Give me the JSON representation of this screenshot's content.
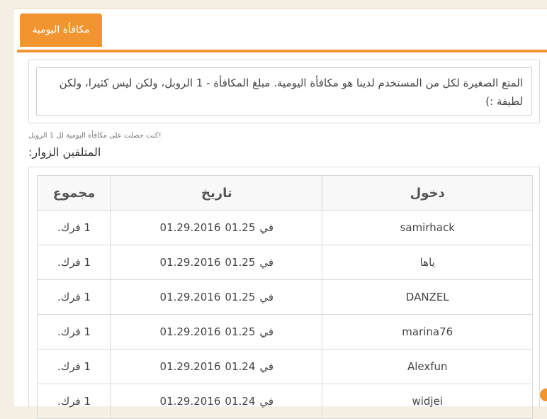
{
  "tab": {
    "label": "مكافأة اليومية"
  },
  "info": {
    "text": "المتع الصغيرة لكل من المستخدم لدينا هو مكافأة اليومية. مبلغ المكافأة - 1 الروبل، ولكن ليس كثيرا، ولكن لطيفة :)"
  },
  "note": {
    "text": "!كنت حصلت على مكافأة اليومية لل 1 الروبل"
  },
  "visitors": {
    "label": "المتلقين الزوار:"
  },
  "table": {
    "headers": {
      "login": "دخول",
      "date": "تاريخ",
      "sum": "مجموع"
    },
    "rows": [
      {
        "login": "samirhack",
        "date": "01.29.2016",
        "in": "في",
        "time": "01.25",
        "sum": "1 فرك."
      },
      {
        "login": "ياها",
        "date": "01.29.2016",
        "in": "في",
        "time": "01.25",
        "sum": "1 فرك."
      },
      {
        "login": "DANZEL",
        "date": "01.29.2016",
        "in": "في",
        "time": "01.25",
        "sum": "1 فرك."
      },
      {
        "login": "marina76",
        "date": "01.29.2016",
        "in": "في",
        "time": "01.25",
        "sum": "1 فرك."
      },
      {
        "login": "Alexfun",
        "date": "01.29.2016",
        "in": "في",
        "time": "01.24",
        "sum": "1 فرك."
      },
      {
        "login": "widjei",
        "date": "01.29.2016",
        "in": "في",
        "time": "01.24",
        "sum": "1 فرك."
      }
    ]
  },
  "colors": {
    "accent": "#f0952f",
    "background": "#f6efe3"
  }
}
